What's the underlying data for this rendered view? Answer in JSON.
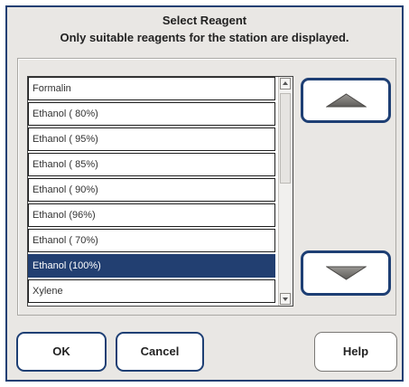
{
  "dialog": {
    "title": "Select Reagent",
    "subtitle": "Only suitable reagents for the station are displayed."
  },
  "reagents": [
    "Formalin",
    "Ethanol ( 80%)",
    "Ethanol ( 95%)",
    "Ethanol ( 85%)",
    "Ethanol ( 90%)",
    "Ethanol (96%)",
    "Ethanol ( 70%)",
    "Ethanol (100%)",
    "Xylene"
  ],
  "selected_reagent": "Ethanol (100%)",
  "icons": {
    "scroll_up": "arrow-up-icon",
    "scroll_down": "arrow-down-icon",
    "page_up": "triangle-up-icon",
    "page_down": "triangle-down-icon"
  },
  "buttons": {
    "ok": "OK",
    "cancel": "Cancel",
    "help": "Help"
  },
  "colors": {
    "accent": "#1e3f74",
    "selection": "#223f71",
    "background": "#e9e7e4"
  }
}
